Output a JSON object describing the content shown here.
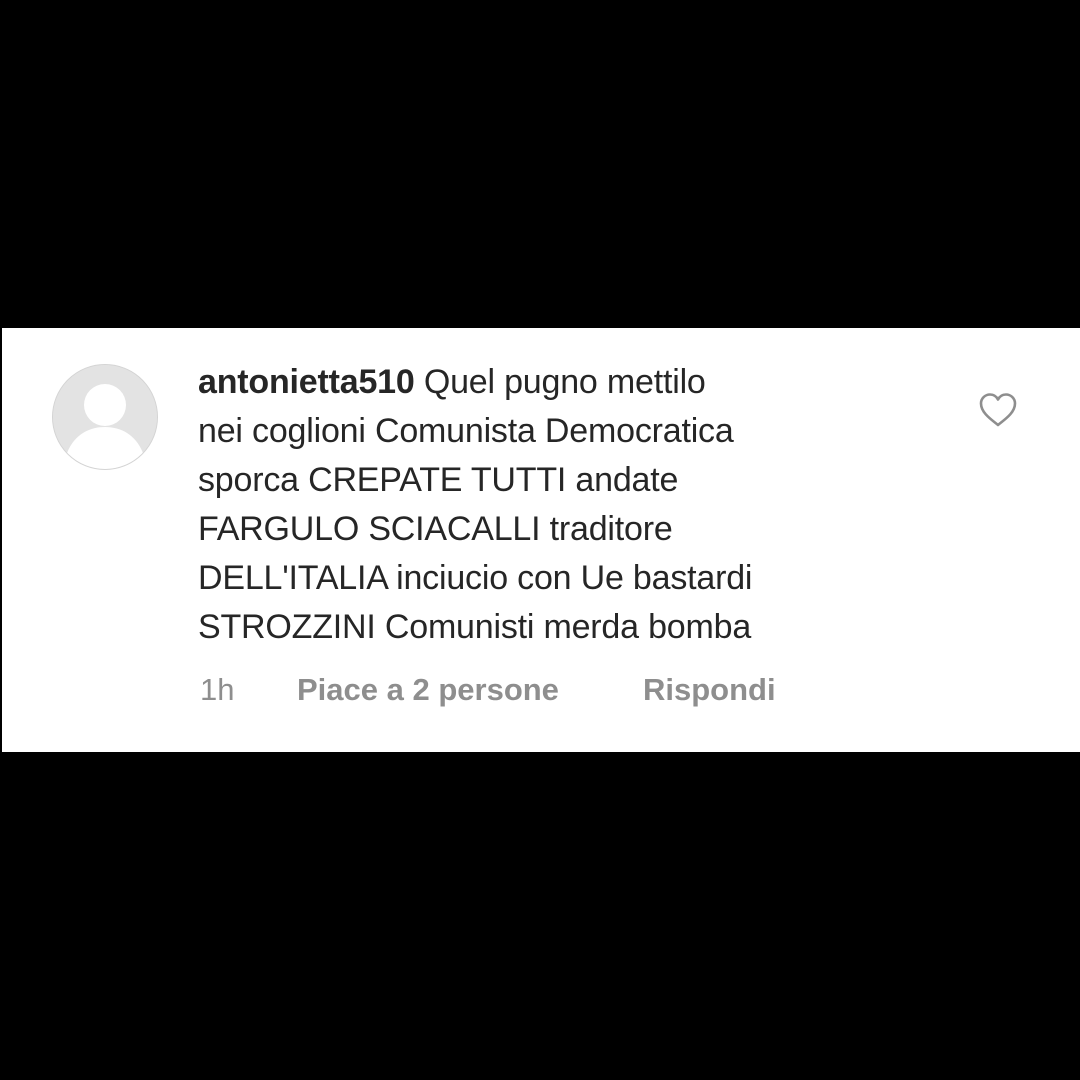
{
  "comment": {
    "username": "antonietta510",
    "body": "Quel pugno mettilo\nnei coglioni Comunista Democratica\nsporca CREPATE TUTTI andate\nFARGULO SCIACALLI  traditore\nDELL'ITALIA  inciucio con Ue  bastardi\nSTROZZINI Comunisti merda bomba",
    "time": "1h",
    "likes_label": "Piace a 2 persone",
    "reply_label": "Rispondi",
    "avatar_icon": "default-user-avatar-icon",
    "like_icon": "heart-outline-icon"
  },
  "colors": {
    "background": "#000000",
    "card": "#ffffff",
    "text": "#262626",
    "meta_text": "#8e8e8e",
    "avatar": "#e3e3e3"
  }
}
